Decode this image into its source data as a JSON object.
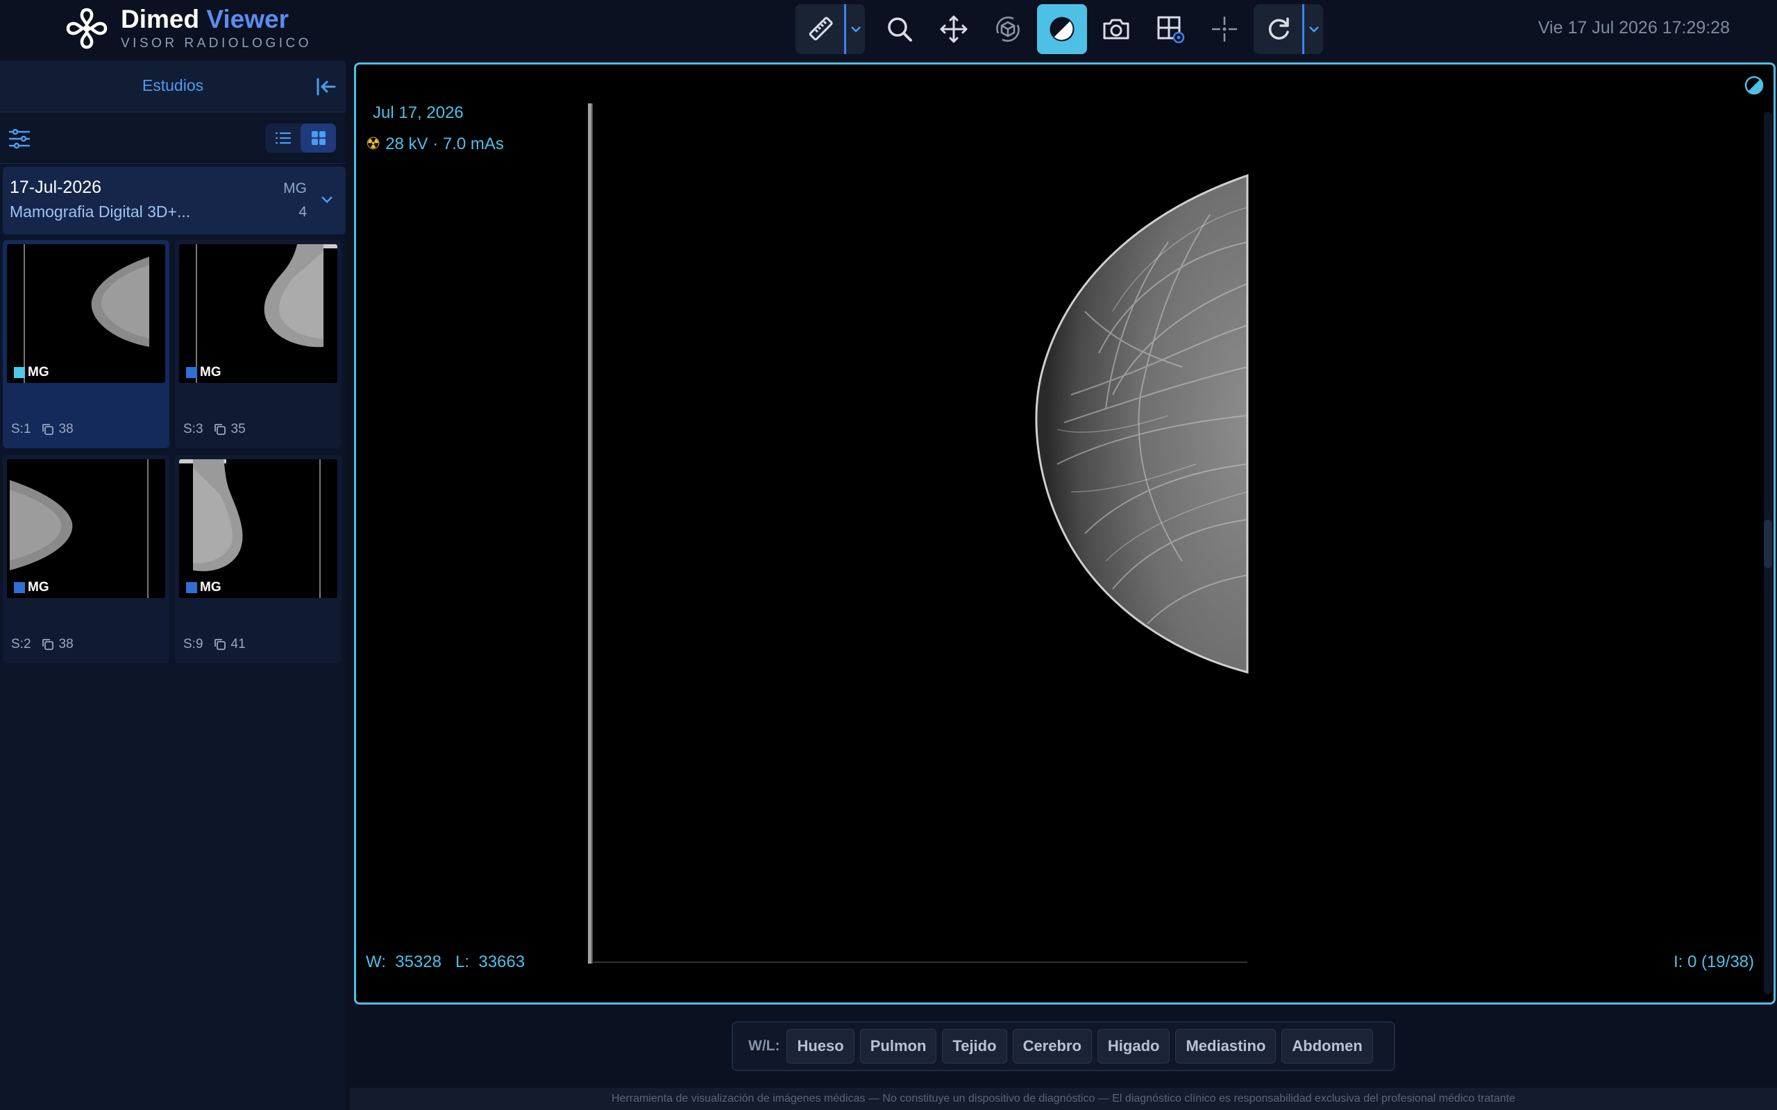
{
  "brand": {
    "name": "Dimed",
    "name_accent": "Viewer",
    "subtitle": "VISOR RADIOLOGICO"
  },
  "clock": "Vie 17 Jul 2026 17:29:28",
  "toolbar": {
    "tools": [
      "ruler-icon",
      "zoom-icon",
      "pan-icon",
      "rotate-3d-icon",
      "window-level-icon",
      "camera-icon",
      "layout-settings-icon",
      "crosshair-icon",
      "reset-icon"
    ],
    "active_tool": "window-level-icon"
  },
  "sidebar": {
    "title": "Estudios",
    "study": {
      "date": "17-Jul-2026",
      "description": "Mamografia Digital 3D+...",
      "modality": "MG",
      "count": "4"
    },
    "series": [
      {
        "modality": "MG",
        "series": "S:1",
        "images": "38",
        "selected": true
      },
      {
        "modality": "MG",
        "series": "S:3",
        "images": "35",
        "selected": false
      },
      {
        "modality": "MG",
        "series": "S:2",
        "images": "38",
        "selected": false
      },
      {
        "modality": "MG",
        "series": "S:9",
        "images": "41",
        "selected": false
      }
    ]
  },
  "viewport": {
    "date": "Jul 17, 2026",
    "exposure": "28 kV · 7.0 mAs",
    "window_label": "W:",
    "window_value": "35328",
    "level_label": "L:",
    "level_value": "33663",
    "image_index": "I: 0 (19/38)"
  },
  "wl_presets": {
    "label": "W/L:",
    "items": [
      "Hueso",
      "Pulmon",
      "Tejido",
      "Cerebro",
      "Higado",
      "Mediastino",
      "Abdomen"
    ]
  },
  "footer": "Herramienta de visualización de imágenes médicas — No constituye un dispositivo de diagnóstico — El diagnóstico clínico es responsabilidad exclusiva del profesional médico tratante",
  "colors": {
    "accent": "#4ec0e6",
    "brand_blue": "#5b8def",
    "background": "#0b1120"
  }
}
